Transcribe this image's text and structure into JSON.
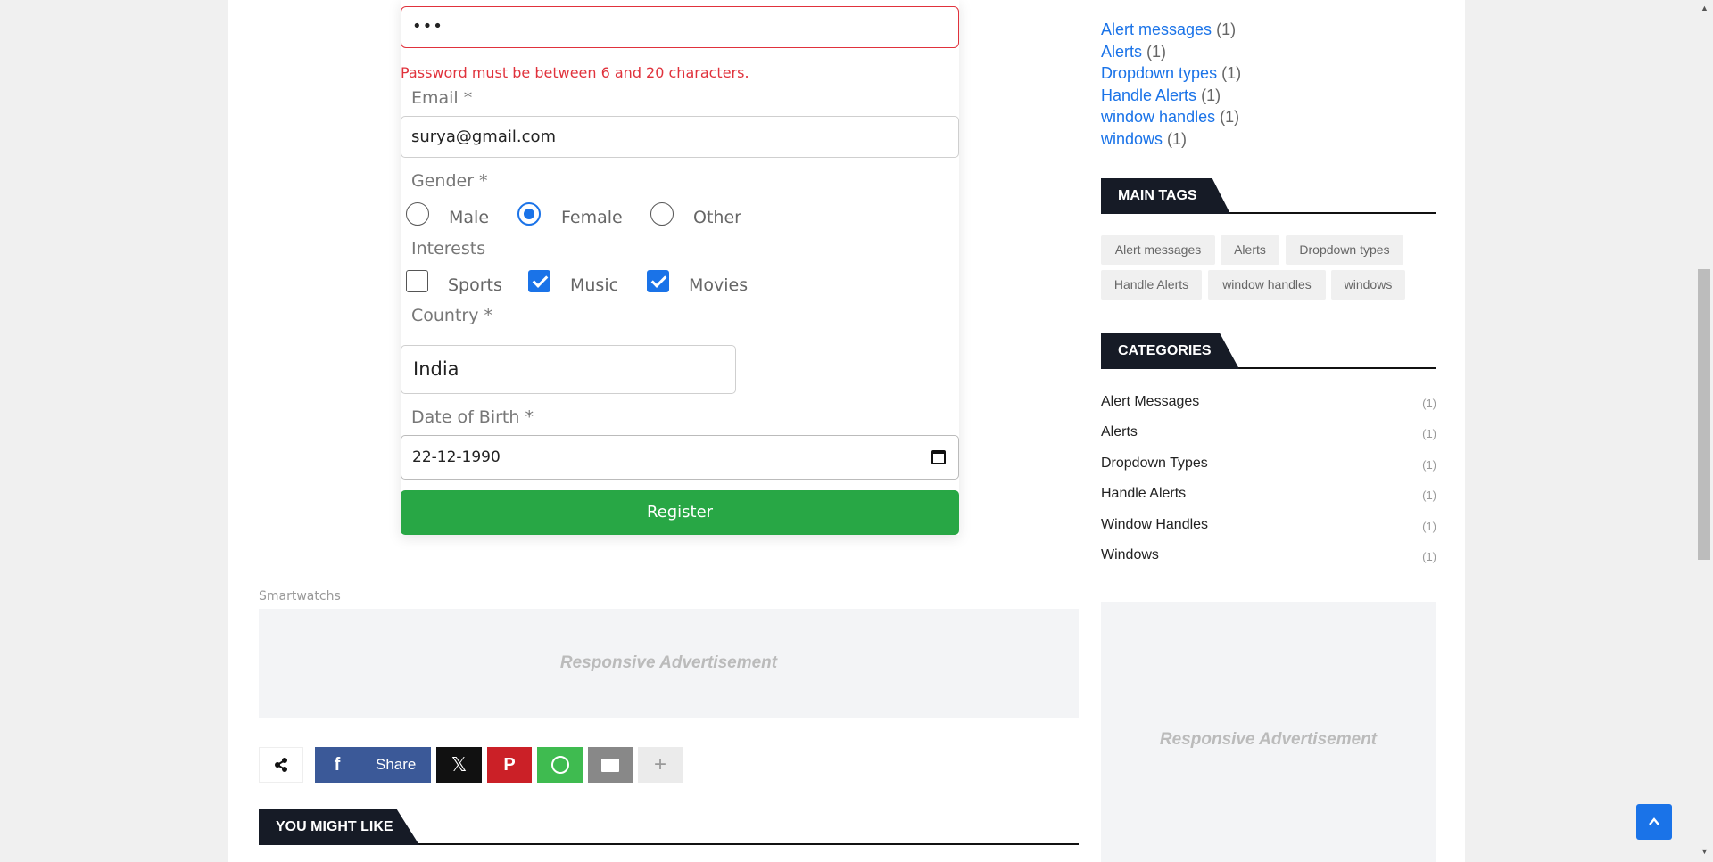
{
  "form": {
    "password_value": "•••",
    "password_error": "Password must be between 6 and 20 characters.",
    "email_label": "Email *",
    "email_value": "surya@gmail.com",
    "gender_label": "Gender *",
    "gender_options": [
      "Male",
      "Female",
      "Other"
    ],
    "gender_selected": "Female",
    "interests_label": "Interests",
    "interests": [
      {
        "label": "Sports",
        "checked": false
      },
      {
        "label": "Music",
        "checked": true
      },
      {
        "label": "Movies",
        "checked": true
      }
    ],
    "country_label": "Country *",
    "country_value": "India",
    "dob_label": "Date of Birth *",
    "dob_value": "22-12-1990",
    "register_label": "Register"
  },
  "ads": {
    "smartwatch_label": "Smartwatchs",
    "ad_text": "Responsive Advertisement"
  },
  "share": {
    "facebook_label": "Share",
    "colors": {
      "facebook": "#3b5998",
      "x": "#111111",
      "pinterest": "#cb2027",
      "whatsapp": "#3fbb50",
      "email": "#888888",
      "more": "#ebebeb"
    }
  },
  "you_might_like": "YOU MIGHT LIKE",
  "sidebar": {
    "tag_links": [
      {
        "name": "Alert messages",
        "count": "(1)"
      },
      {
        "name": "Alerts",
        "count": "(1)"
      },
      {
        "name": "Dropdown types",
        "count": "(1)"
      },
      {
        "name": "Handle Alerts",
        "count": "(1)"
      },
      {
        "name": "window handles",
        "count": "(1)"
      },
      {
        "name": "windows",
        "count": "(1)"
      }
    ],
    "main_tags_title": "MAIN TAGS",
    "main_tags": [
      "Alert messages",
      "Alerts",
      "Dropdown types",
      "Handle Alerts",
      "window handles",
      "windows"
    ],
    "categories_title": "CATEGORIES",
    "categories": [
      {
        "name": "Alert Messages",
        "count": "(1)"
      },
      {
        "name": "Alerts",
        "count": "(1)"
      },
      {
        "name": "Dropdown Types",
        "count": "(1)"
      },
      {
        "name": "Handle Alerts",
        "count": "(1)"
      },
      {
        "name": "Window Handles",
        "count": "(1)"
      },
      {
        "name": "Windows",
        "count": "(1)"
      }
    ]
  },
  "accent_color": "#1a73e8",
  "error_color": "#e0323c",
  "register_color": "#28a745"
}
